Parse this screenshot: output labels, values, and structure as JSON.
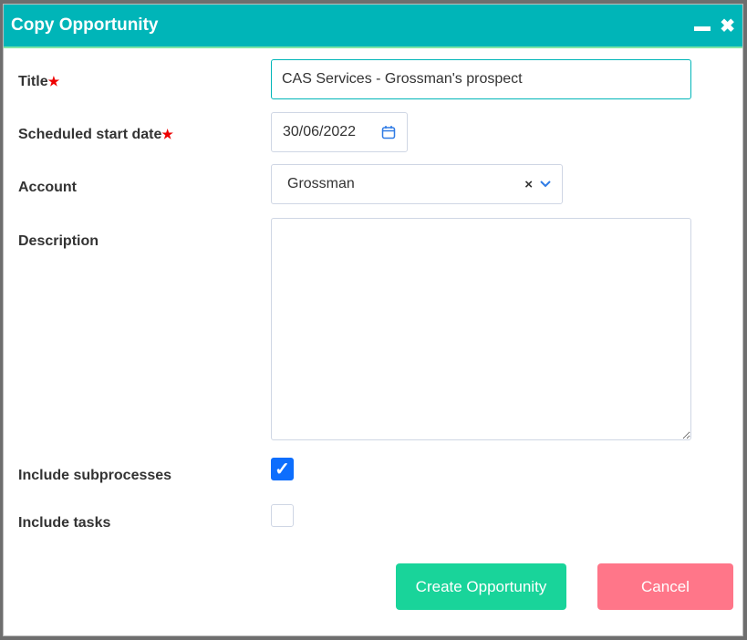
{
  "dialog": {
    "title": "Copy Opportunity"
  },
  "fields": {
    "title": {
      "label": "Title",
      "value": "CAS Services - Grossman's prospect"
    },
    "start_date": {
      "label": "Scheduled start date",
      "value": "30/06/2022"
    },
    "account": {
      "label": "Account",
      "value": "Grossman"
    },
    "description": {
      "label": "Description",
      "value": ""
    },
    "include_subprocesses": {
      "label": "Include subprocesses",
      "checked": true
    },
    "include_tasks": {
      "label": "Include tasks",
      "checked": false
    }
  },
  "buttons": {
    "create": "Create Opportunity",
    "cancel": "Cancel"
  },
  "colors": {
    "header": "#00b5b8",
    "create": "#19d49a",
    "cancel": "#ff7689"
  }
}
